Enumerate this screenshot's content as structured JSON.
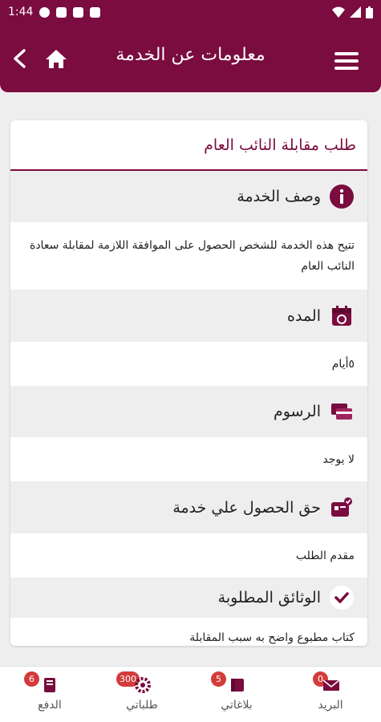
{
  "status_bar": {
    "time": "1:44"
  },
  "header": {
    "title": "معلومات عن الخدمة"
  },
  "card": {
    "title": "طلب مقابلة النائب العام",
    "sections": [
      {
        "heading": "وصف الخدمة",
        "icon": "info-icon",
        "body": "تتيح هذه الخدمة للشخص الحصول على الموافقة اللازمة لمقابلة سعادة النائب العام"
      },
      {
        "heading": "المده",
        "icon": "calendar-icon",
        "body": "٥أيام"
      },
      {
        "heading": "الرسوم",
        "icon": "fees-icon",
        "body": "لا يوجد"
      },
      {
        "heading": "حق الحصول علي خدمة",
        "icon": "eligibility-icon",
        "body": "مقدم الطلب"
      },
      {
        "heading": "الوثائق المطلوبة",
        "icon": "checkmark-icon",
        "body": "كتاب مطبوع واضح به سبب المقابلة"
      }
    ]
  },
  "bottom_nav": [
    {
      "label": "البريد",
      "badge": "0",
      "icon": "mail-icon"
    },
    {
      "label": "بلاغاتي",
      "badge": "5",
      "icon": "reports-icon"
    },
    {
      "label": "طلباتي",
      "badge": "300",
      "icon": "requests-gear-icon"
    },
    {
      "label": "الدفع",
      "badge": "6",
      "icon": "payment-icon"
    }
  ],
  "colors": {
    "brand": "#7a0c3f",
    "badge": "#d43b3b",
    "section_bg": "#eeeeee"
  }
}
